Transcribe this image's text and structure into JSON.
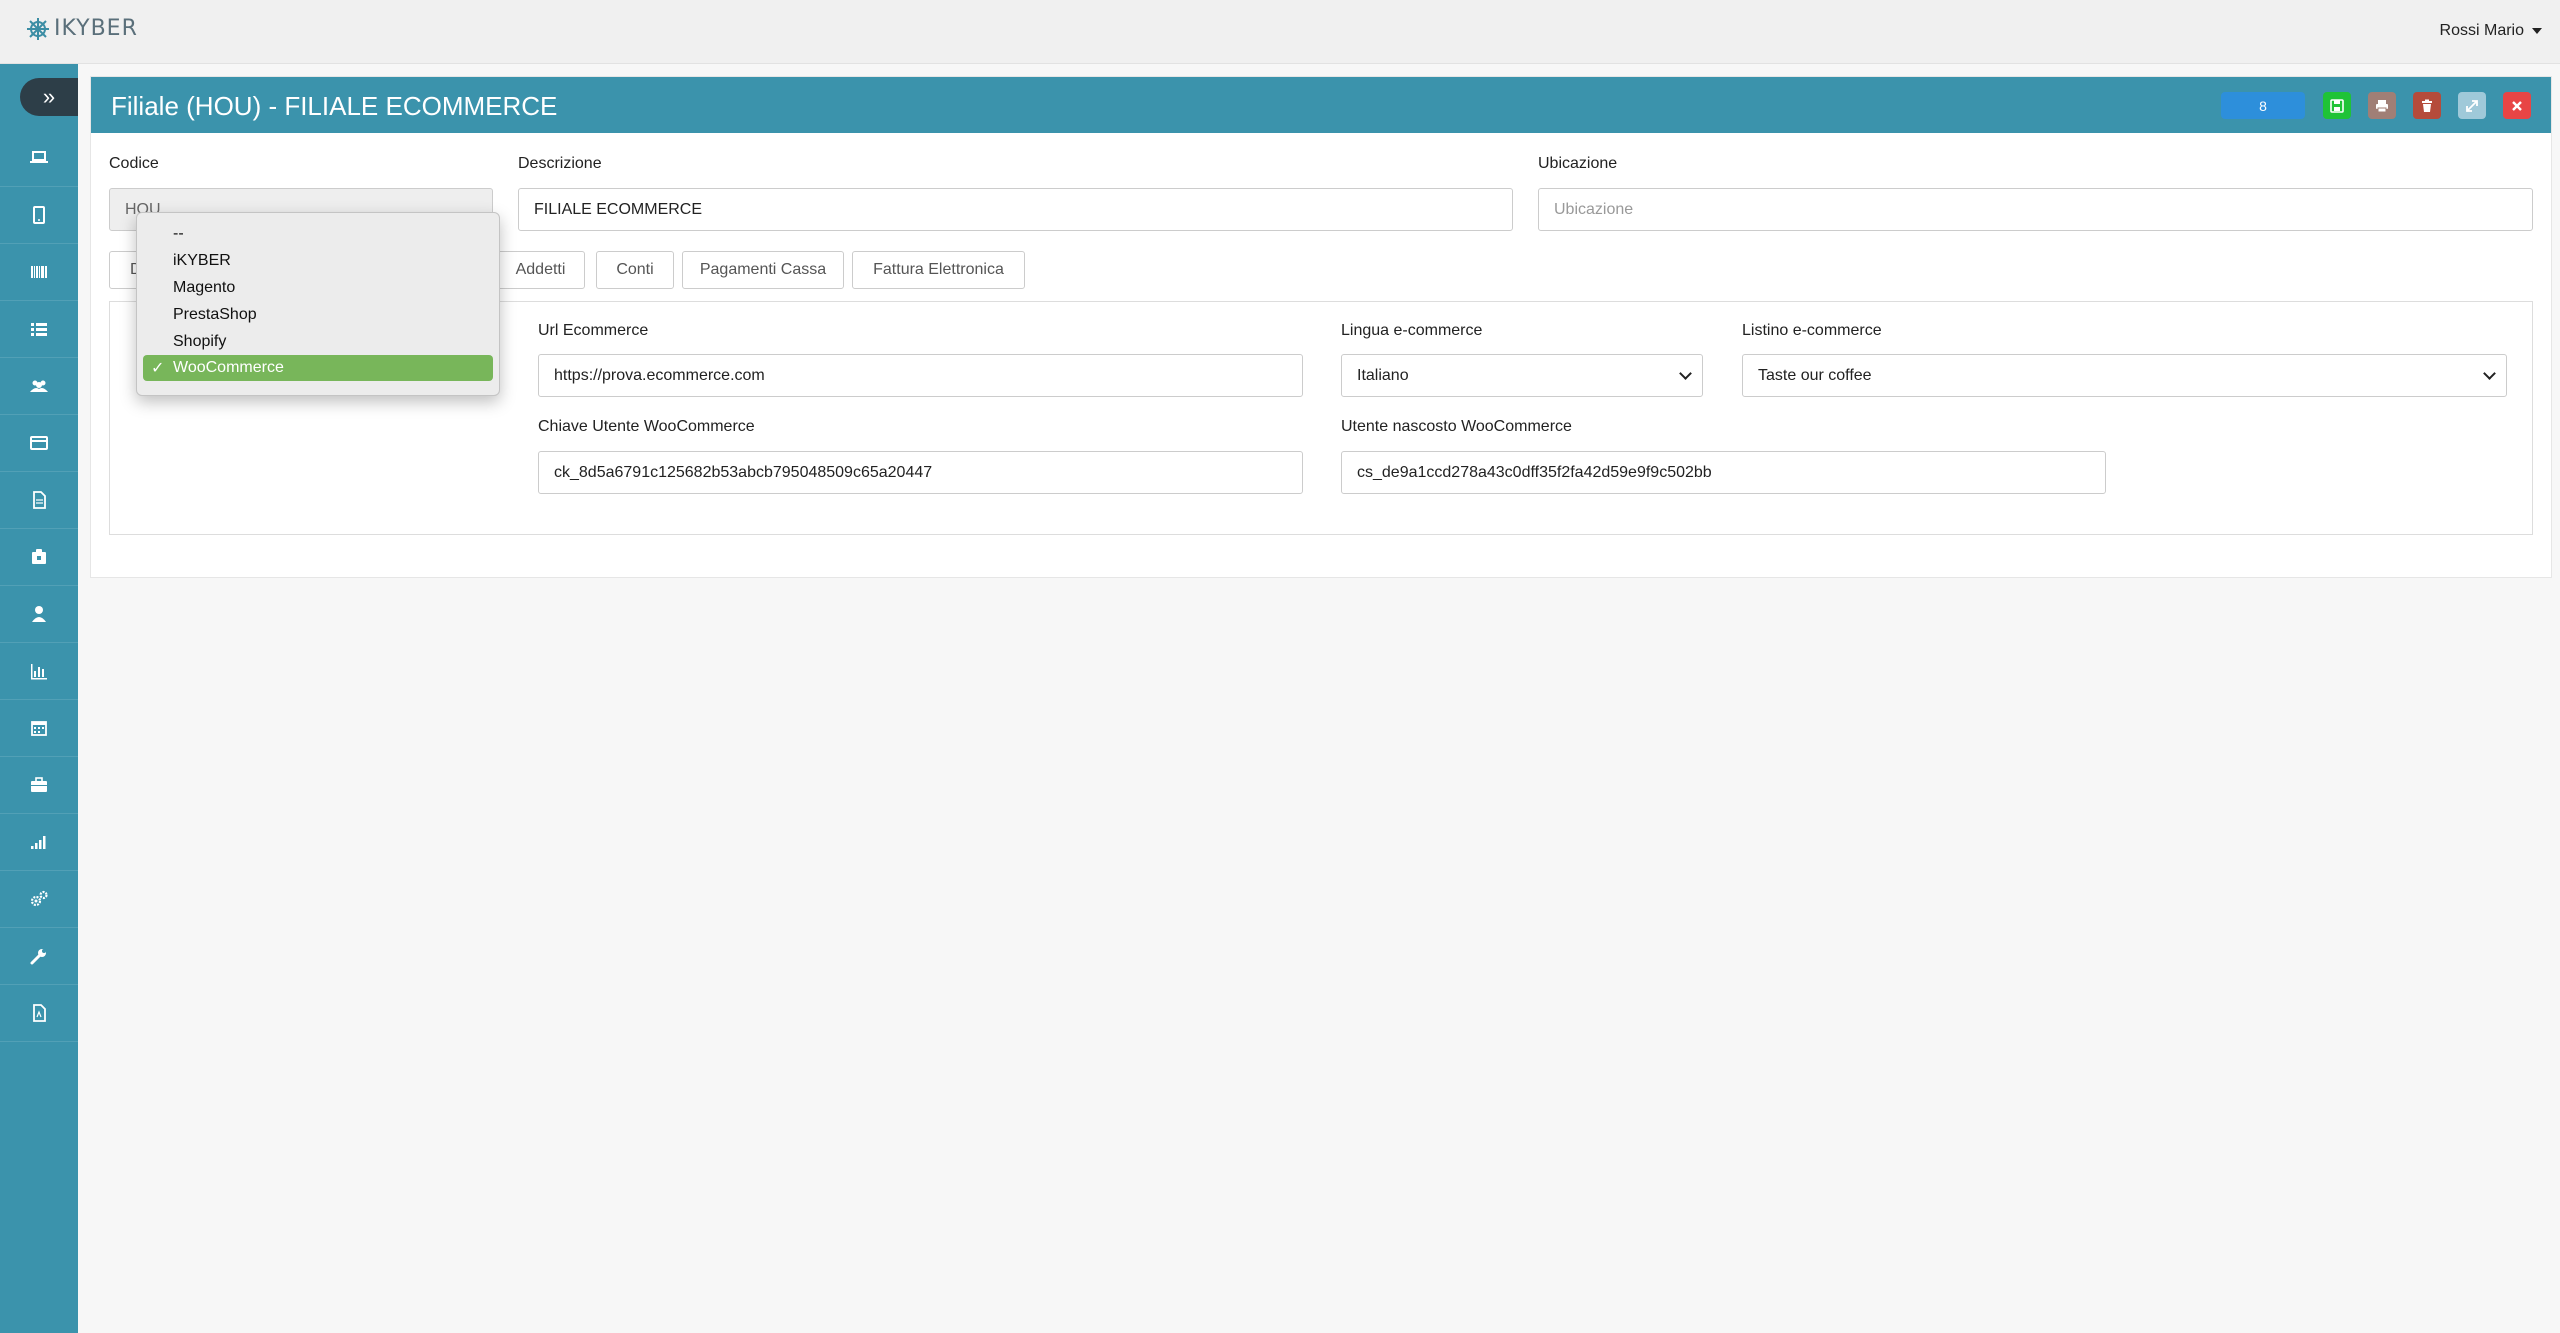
{
  "app": {
    "logo_text": "IKYBER",
    "user_name": "Rossi Mario"
  },
  "sidebar": {
    "toggle_glyph": "»",
    "items": [
      {
        "icon": "laptop-icon"
      },
      {
        "icon": "tablet-icon"
      },
      {
        "icon": "barcode-icon"
      },
      {
        "icon": "list-icon"
      },
      {
        "icon": "users-icon"
      },
      {
        "icon": "credit-card-icon"
      },
      {
        "icon": "document-icon"
      },
      {
        "icon": "clipboard-icon"
      },
      {
        "icon": "user-icon"
      },
      {
        "icon": "bar-chart-icon"
      },
      {
        "icon": "calendar-icon"
      },
      {
        "icon": "briefcase-icon"
      },
      {
        "icon": "signal-icon"
      },
      {
        "icon": "gears-icon"
      },
      {
        "icon": "wrench-icon"
      },
      {
        "icon": "pdf-icon"
      }
    ]
  },
  "panel": {
    "title": "Filiale (HOU) - FILIALE ECOMMERCE",
    "badge": "8",
    "colors": {
      "header": "#3b93ac",
      "badge": "#2d8fdb",
      "save": "#1fc337",
      "print": "#a07f76",
      "delete": "#b54b3b",
      "expand": "#9fc9d9",
      "close": "#e84545"
    }
  },
  "form": {
    "codice_label": "Codice",
    "codice_value": "HOU",
    "descrizione_label": "Descrizione",
    "descrizione_value": "FILIALE ECOMMERCE",
    "ubicazione_label": "Ubicazione",
    "ubicazione_placeholder": "Ubicazione"
  },
  "tabs": [
    {
      "label": "D"
    },
    {
      "label": "Addetti"
    },
    {
      "label": "Conti"
    },
    {
      "label": "Pagamenti Cassa"
    },
    {
      "label": "Fattura Elettronica"
    }
  ],
  "ecommerce": {
    "url_label": "Url Ecommerce",
    "url_value": "https://prova.ecommerce.com",
    "lingua_label": "Lingua e-commerce",
    "lingua_value": "Italiano",
    "listino_label": "Listino e-commerce",
    "listino_value": "Taste our coffee",
    "chiave_label": "Chiave Utente WooCommerce",
    "chiave_value": "ck_8d5a6791c125682b53abcb795048509c65a20447",
    "nascosto_label": "Utente nascosto WooCommerce",
    "nascosto_value": "cs_de9a1ccd278a43c0dff35f2fa42d59e9f9c502bb"
  },
  "platform_dropdown": {
    "options": [
      "--",
      "iKYBER",
      "Magento",
      "PrestaShop",
      "Shopify",
      "WooCommerce"
    ],
    "selected": "WooCommerce",
    "check_glyph": "✓",
    "selected_color": "#78b65a"
  }
}
